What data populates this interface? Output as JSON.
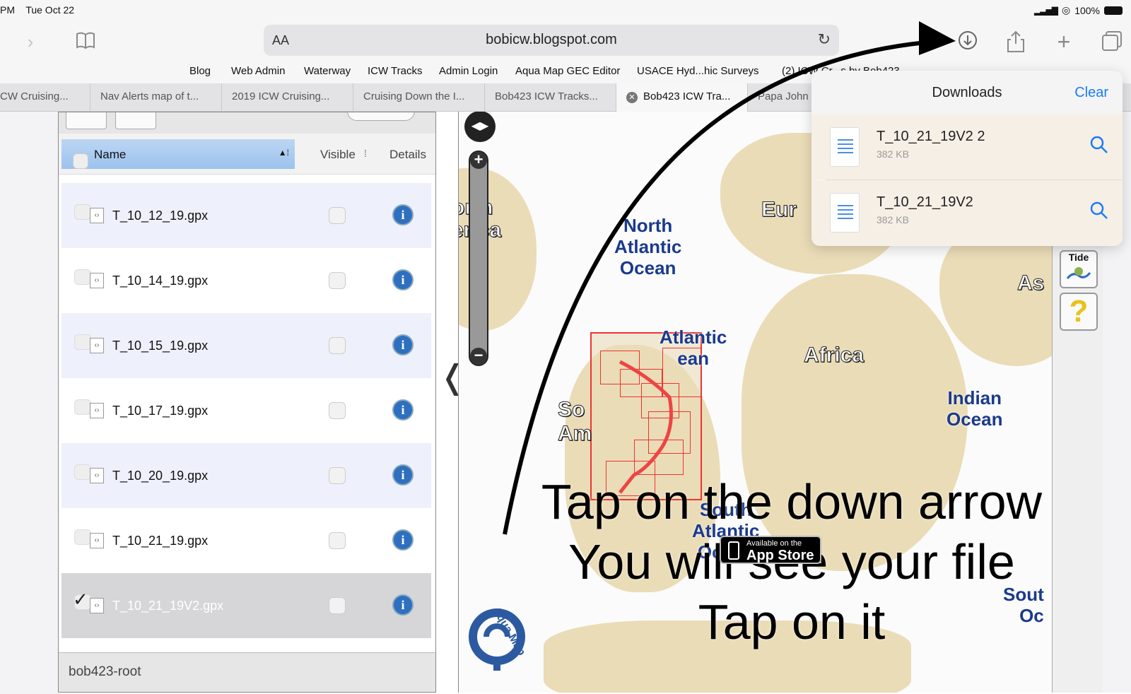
{
  "status_bar": {
    "time": "PM",
    "date": "Tue Oct 22",
    "battery": "100%"
  },
  "toolbar": {
    "reader_label": "AA",
    "url": "bobicw.blogspot.com",
    "icons": [
      "forward-icon",
      "bookmarks-icon",
      "reload-icon",
      "downloads-icon",
      "share-icon",
      "plus-icon",
      "tabs-icon"
    ]
  },
  "bookmarks": [
    "Blog",
    "Web Admin",
    "Waterway",
    "ICW Tracks",
    "Admin Login",
    "Aqua Map GEC Editor",
    "USACE Hyd...hic Surveys",
    "(2) ICW Cr...s by Bob423"
  ],
  "tabs": [
    "CW Cruising...",
    "Nav Alerts map of t...",
    "2019 ICW Cruising...",
    "Cruising Down the I...",
    "Bob423 ICW Tracks...",
    "Bob423 ICW Tra...",
    "Papa John"
  ],
  "file_panel": {
    "columns": {
      "name": "Name",
      "visible": "Visible",
      "details": "Details"
    },
    "rows": [
      {
        "name": "T_10_12_19.gpx",
        "checked": false
      },
      {
        "name": "T_10_14_19.gpx",
        "checked": false
      },
      {
        "name": "T_10_15_19.gpx",
        "checked": false
      },
      {
        "name": "T_10_17_19.gpx",
        "checked": false
      },
      {
        "name": "T_10_20_19.gpx",
        "checked": false
      },
      {
        "name": "T_10_21_19.gpx",
        "checked": false
      },
      {
        "name": "T_10_21_19V2.gpx",
        "checked": true
      }
    ],
    "footer": "bob423-root",
    "collapse_glyph": "❬"
  },
  "map": {
    "labels": {
      "north_america": "orth\nerica",
      "europe": "Eur",
      "asia": "As",
      "africa": "Africa",
      "south_america": "So\nAm",
      "north_atlantic": "North\nAtlantic\nOcean",
      "atlantic": "Atlantic\nean",
      "south_atlantic": "South\nAtlantic\nOcean",
      "indian": "Indian\nOcean",
      "southern": "Sout\nOc"
    },
    "tide_label": "Tide",
    "help_glyph": "?",
    "instructions": [
      "Tap on the down arrow",
      "You will see your file",
      "Tap on it"
    ],
    "app_store": {
      "small": "Available on the",
      "big": "App Store"
    },
    "logo_text": "Aqua Map"
  },
  "downloads": {
    "title": "Downloads",
    "clear": "Clear",
    "items": [
      {
        "name": "T_10_21_19V2 2",
        "size": "382 KB"
      },
      {
        "name": "T_10_21_19V2",
        "size": "382 KB"
      }
    ]
  },
  "colors": {
    "accent": "#1a7cf5",
    "info": "#2f6fc0",
    "land": "#eadcb7",
    "ocean_label": "#1b3a8c"
  }
}
